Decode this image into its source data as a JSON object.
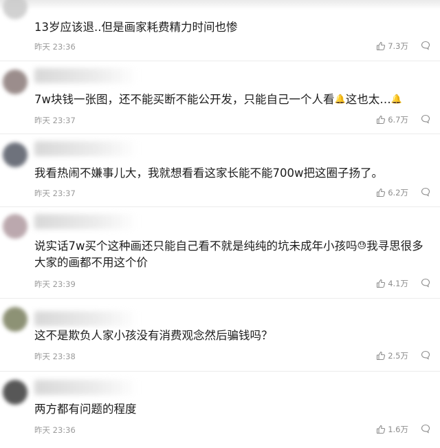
{
  "comments": [
    {
      "text": "13岁应该退..但是画家耗费精力时间也惨",
      "time": "昨天 23:36",
      "likes": "7.3万",
      "avatar_color": "#c9c9c9"
    },
    {
      "text": "7w块钱一张图，还不能买断不能公开发，只能自己一个人看",
      "text_mid": "这也太…",
      "emoji": "🔔",
      "time": "昨天 23:37",
      "likes": "6.7万",
      "avatar_color": "#8a7a78"
    },
    {
      "text": "我看热闹不嫌事儿大，我就想看看这家长能不能700w把这圈子扬了。",
      "time": "昨天 23:37",
      "likes": "6.2万",
      "avatar_color": "#555a66"
    },
    {
      "text": "说实话7w买个这种画还只能自己看不就是纯纯的坑未成年小孩吗",
      "text_tail": "我寻思很多大家的画都不用这个价",
      "emoji": "😓",
      "time": "昨天 23:39",
      "likes": "4.1万",
      "avatar_color": "#b09aa0"
    },
    {
      "text": "这不是欺负人家小孩没有消费观念然后骗钱吗？",
      "time": "昨天 23:38",
      "likes": "2.5万",
      "avatar_color": "#7a7f5e"
    },
    {
      "text": "两方都有问题的程度",
      "time": "昨天 23:36",
      "likes": "1.6万",
      "avatar_color": "#3a3a3a"
    }
  ],
  "icons": {
    "like": "thumbs-up-icon",
    "more": "more-comment-icon"
  }
}
